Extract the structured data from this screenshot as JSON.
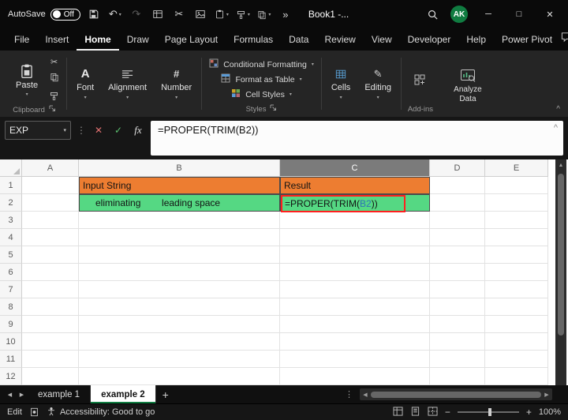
{
  "titlebar": {
    "autosave_label": "AutoSave",
    "autosave_state": "Off",
    "workbook_title": "Book1 -...",
    "avatar_initials": "AK"
  },
  "ribbon_tabs": {
    "items": [
      "File",
      "Insert",
      "Home",
      "Draw",
      "Page Layout",
      "Formulas",
      "Data",
      "Review",
      "View",
      "Developer",
      "Help",
      "Power Pivot"
    ],
    "active": "Home"
  },
  "ribbon": {
    "paste_label": "Paste",
    "clipboard_group_label": "Clipboard",
    "font_label": "Font",
    "alignment_label": "Alignment",
    "number_label": "Number",
    "styles_items": [
      "Conditional Formatting",
      "Format as Table",
      "Cell Styles"
    ],
    "styles_group_label": "Styles",
    "cells_label": "Cells",
    "editing_label": "Editing",
    "addins_group_label": "Add-ins",
    "analyze_data_label": "Analyze Data"
  },
  "formula_bar": {
    "name_box": "EXP",
    "formula": "=PROPER(TRIM(B2))"
  },
  "grid": {
    "columns": [
      "A",
      "B",
      "C",
      "D",
      "E"
    ],
    "selected_column": "C",
    "row_count": 12,
    "cells": {
      "B1": "Input String",
      "C1": "Result",
      "B2": "      eliminating        leading space",
      "C2_prefix": "=PROPER(TRIM(",
      "C2_ref": "B2",
      "C2_suffix": "))"
    },
    "colors": {
      "header_fill": "#ED7D31",
      "data_fill": "#55D883",
      "edit_border": "#FF1F1F",
      "ref_text": "#2E75B6"
    }
  },
  "sheet_tabs": {
    "tabs": [
      "example 1",
      "example 2"
    ],
    "active": "example 2"
  },
  "status_bar": {
    "mode": "Edit",
    "accessibility": "Accessibility: Good to go",
    "zoom": "100%"
  },
  "colors": {
    "excel_green": "#107C41"
  },
  "icons": {
    "undo": "↶",
    "redo": "↷",
    "cut": "✂",
    "overflow": "»",
    "menu_dots": "⋮",
    "chevron_down": "▾",
    "collapse_up": "^",
    "minimize": "─",
    "maximize": "□",
    "close": "✕",
    "cancel": "✕",
    "enter": "✓",
    "fx": "fx",
    "font_a": "A",
    "number_sign": "#",
    "editing_pencil": "✎",
    "add_sheet": "+",
    "zoom_out": "−",
    "zoom_in": "+",
    "nav_left": "◀",
    "nav_right": "▶"
  }
}
